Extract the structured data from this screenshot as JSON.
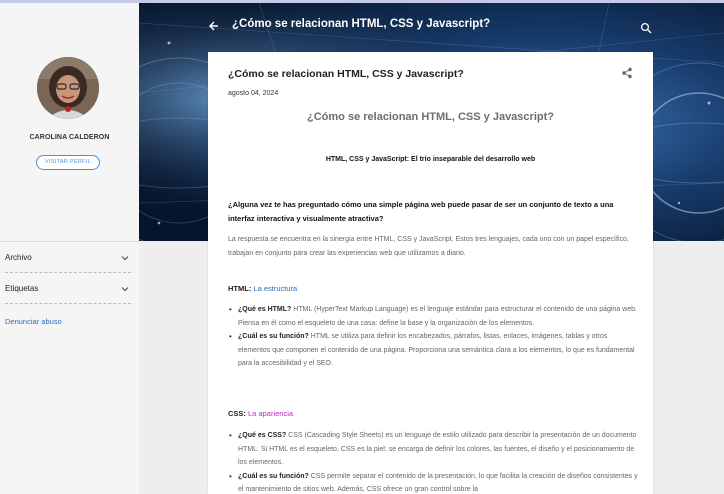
{
  "header": {
    "title": "¿Cómo se relacionan HTML, CSS y Javascript?",
    "back_icon": "arrow-left-icon",
    "search_icon": "search-icon"
  },
  "profile": {
    "name": "CAROLINA CALDERON",
    "visit_label": "VISITAR PERFIL"
  },
  "sidebar": {
    "items": [
      {
        "label": "Archivo"
      },
      {
        "label": "Etiquetas"
      }
    ],
    "report_label": "Denunciar abuso"
  },
  "post": {
    "title": "¿Cómo se relacionan HTML, CSS y Javascript?",
    "date": "agosto 04, 2024",
    "heading": "¿Cómo se relacionan HTML, CSS y Javascript?",
    "subheading": "HTML, CSS y JavaScript: El trío inseparable del desarrollo web",
    "intro_question": "¿Alguna vez te has preguntado cómo una simple página web puede pasar de ser un conjunto de texto a una interfaz interactiva y visualmente atractiva?",
    "intro_text": "La respuesta se encuentra en la sinergia entre HTML, CSS y JavaScript. Estos tres lenguajes, cada uno con un papel específico, trabajan en conjunto para crear las experiencias web que utilizamos a diario.",
    "sections": [
      {
        "label": "HTML:",
        "highlight": "La estructura",
        "bullets": [
          {
            "q": "¿Qué es HTML?",
            "text": " HTML (HyperText Markup Language) es el lenguaje estándar para estructurar el contenido de una página web. Piensa en él como el esqueleto de una casa: define la base y la organización de los elementos."
          },
          {
            "q": "¿Cuál es su función?",
            "text": " HTML se utiliza para definir los encabezados, párrafos, listas, enlaces, imágenes, tablas y otros elementos que componen el contenido de una página. Proporciona una semántica clara a los elementos, lo que es fundamental para la accesibilidad y el SEO."
          }
        ]
      },
      {
        "label": "CSS:",
        "highlight": "La apariencia",
        "bullets": [
          {
            "q": "¿Qué es CSS?",
            "text": " CSS (Cascading Style Sheets) es un lenguaje de estilo utilizado para describir la presentación de un documento HTML. Si HTML es el esqueleto, CSS es la piel: se encarga de definir los colores, las fuentes, el diseño y el posicionamiento de los elementos."
          },
          {
            "q": "¿Cuál es su función?",
            "text": " CSS permite separar el contenido de la presentación, lo que facilita la creación de diseños consistentes y el mantenimiento de sitios web. Además, CSS ofrece un gran control sobre la"
          }
        ]
      }
    ],
    "share_icon": "share-icon"
  },
  "colors": {
    "accent": "#4a90e2",
    "link": "#2a6ebd",
    "highlight_magenta": "#c71fd0",
    "hero_bg": "#0b1d38"
  }
}
